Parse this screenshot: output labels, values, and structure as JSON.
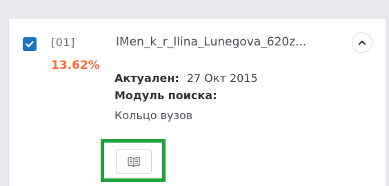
{
  "source": {
    "checked": true,
    "index": "[01]",
    "percent": "13.62%",
    "name": "IMen_k_r_Ilina_Lunegova_620z...",
    "actual_label": "Актуален:",
    "actual_value": "27 Окт 2015",
    "module_label": "Модуль поиска:",
    "module_value": "Кольцо вузов"
  },
  "icons": {
    "checkbox": "checkmark-icon",
    "collapse": "chevron-up-icon",
    "view": "book-icon"
  },
  "colors": {
    "checkbox": "#1f73c4",
    "percent": "#ff6a3d",
    "highlight": "#1fa33a"
  }
}
